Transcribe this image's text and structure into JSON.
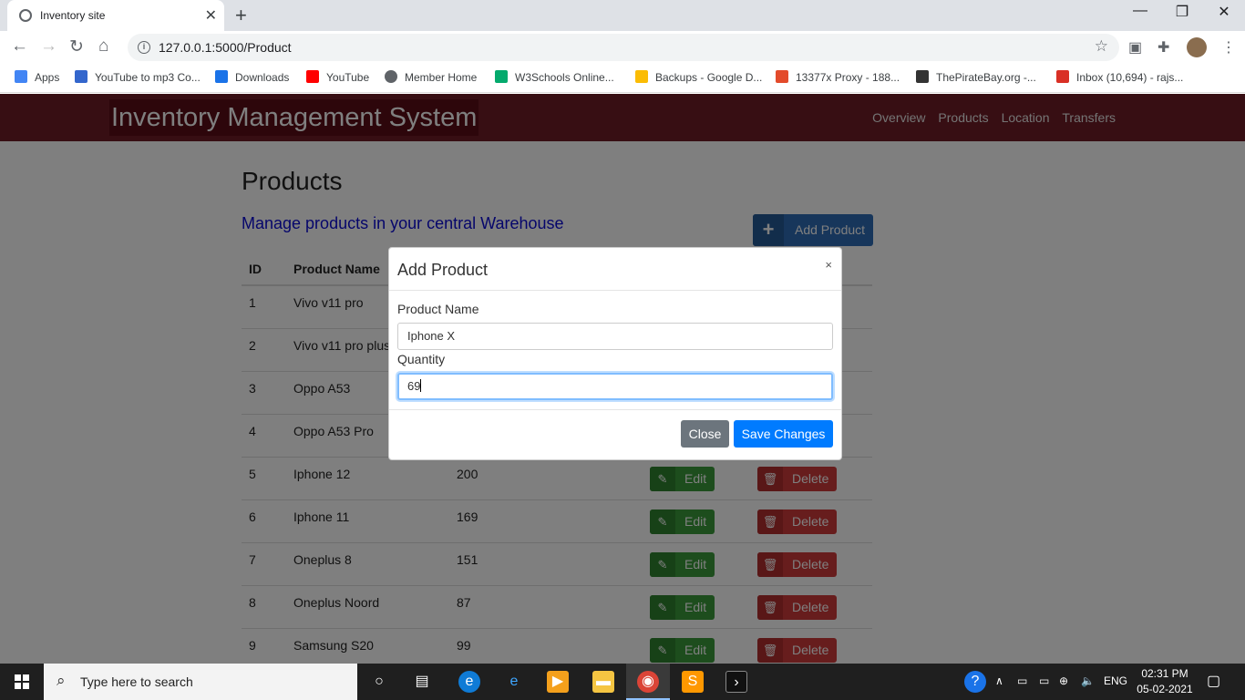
{
  "browser": {
    "tab_title": "Inventory site",
    "url": "127.0.0.1:5000/Product",
    "new_tab": "+",
    "bookmarks": [
      {
        "label": "Apps",
        "color": "#e8453c"
      },
      {
        "label": "YouTube to mp3 Co...",
        "color": "#3366cc"
      },
      {
        "label": "Downloads",
        "color": "#1a73e8"
      },
      {
        "label": "YouTube",
        "color": "#ff0000"
      },
      {
        "label": "Member Home",
        "color": "#5f6368"
      },
      {
        "label": "W3Schools Online...",
        "color": "#04aa6d"
      },
      {
        "label": "Backups - Google D...",
        "color": "#fbbc04"
      },
      {
        "label": "13377x Proxy - 188...",
        "color": "#e34b2b"
      },
      {
        "label": "ThePirateBay.org -...",
        "color": "#333333"
      },
      {
        "label": "Inbox (10,694) - rajs...",
        "color": "#d93025"
      }
    ]
  },
  "app": {
    "brand": "Inventory Management System",
    "nav": [
      "Overview",
      "Products",
      "Location",
      "Transfers"
    ],
    "heading": "Products",
    "subtitle": "Manage products in your central Warehouse",
    "add_button": "Add Product",
    "table": {
      "headers": [
        "ID",
        "Product Name"
      ],
      "rows": [
        {
          "id": "1",
          "name": "Vivo v11 pro",
          "qty": ""
        },
        {
          "id": "2",
          "name": "Vivo v11 pro plus",
          "qty": ""
        },
        {
          "id": "3",
          "name": "Oppo A53",
          "qty": ""
        },
        {
          "id": "4",
          "name": "Oppo A53 Pro",
          "qty": ""
        },
        {
          "id": "5",
          "name": "Iphone 12",
          "qty": "200"
        },
        {
          "id": "6",
          "name": "Iphone 11",
          "qty": "169"
        },
        {
          "id": "7",
          "name": "Oneplus 8",
          "qty": "151"
        },
        {
          "id": "8",
          "name": "Oneplus Noord",
          "qty": "87"
        },
        {
          "id": "9",
          "name": "Samsung S20",
          "qty": "99"
        }
      ],
      "edit_label": "Edit",
      "delete_label": "Delete"
    }
  },
  "modal": {
    "title": "Add Product",
    "close_x": "×",
    "name_label": "Product Name",
    "name_value": "Iphone X",
    "qty_label": "Quantity",
    "qty_value": "69",
    "close_button": "Close",
    "save_button": "Save Changes"
  },
  "taskbar": {
    "search_placeholder": "Type here to search",
    "language": "ENG",
    "time": "02:31 PM",
    "date": "05-02-2021"
  },
  "colors": {
    "navbar": "#6e1c26",
    "primary": "#007bff",
    "success": "#3a9a3a",
    "danger": "#cf3a3a"
  }
}
